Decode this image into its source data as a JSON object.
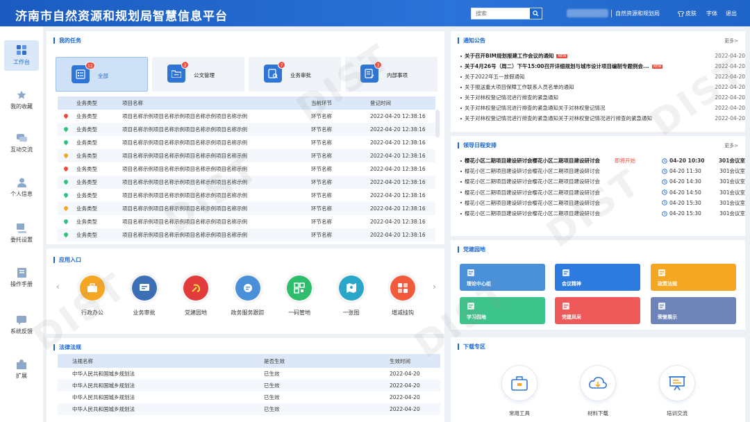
{
  "header": {
    "title": "济南市自然资源和规划局智慧信息平台",
    "search_placeholder": "搜索",
    "org_name": "自然资源和规划局",
    "links": {
      "skin": "皮肤",
      "font": "字体",
      "logout": "退出"
    }
  },
  "sidebar": {
    "items": [
      {
        "label": "工作台",
        "icon": "dashboard-icon"
      },
      {
        "label": "我的收藏",
        "icon": "star-icon"
      },
      {
        "label": "互动交流",
        "icon": "chat-icon"
      },
      {
        "label": "个人信息",
        "icon": "user-icon"
      },
      {
        "label": "委托设置",
        "icon": "delegate-icon"
      },
      {
        "label": "操作手册",
        "icon": "book-icon"
      },
      {
        "label": "系统反馈",
        "icon": "feedback-icon"
      },
      {
        "label": "扩展",
        "icon": "puzzle-icon"
      }
    ]
  },
  "tasks": {
    "title": "我的任务",
    "cards": [
      {
        "label": "全部",
        "badge": "12"
      },
      {
        "label": "公文管理",
        "badge": "2"
      },
      {
        "label": "业务审批",
        "badge": "7"
      },
      {
        "label": "内部事项",
        "badge": "3"
      }
    ],
    "columns": [
      "业务类型",
      "项目名称",
      "当前环节",
      "登记时间"
    ],
    "rows": [
      {
        "type": "业务类型",
        "name": "项目名称示例项目名称示例项目名称示例项目名称示例",
        "step": "环节名称",
        "time": "2022-04-20  12:38:16",
        "pin": "#ef4a3c"
      },
      {
        "type": "业务类型",
        "name": "项目名称示例项目名称示例项目名称示例项目名称示例",
        "step": "环节名称",
        "time": "2022-04-20  12:38:16",
        "pin": "#2ec27e"
      },
      {
        "type": "业务类型",
        "name": "项目名称示例项目名称示例项目名称示例项目名称示例",
        "step": "环节名称",
        "time": "2022-04-20  12:38:16",
        "pin": "#2ec27e"
      },
      {
        "type": "业务类型",
        "name": "项目名称示例项目名称示例项目名称示例项目名称示例",
        "step": "环节名称",
        "time": "2022-04-20  12:38:16",
        "pin": "#f5a623"
      },
      {
        "type": "业务类型",
        "name": "项目名称示例项目名称示例项目名称示例项目名称示例",
        "step": "环节名称",
        "time": "2022-04-20  12:38:16",
        "pin": "#ef4a3c"
      },
      {
        "type": "业务类型",
        "name": "项目名称示例项目名称示例项目名称示例项目名称示例",
        "step": "环节名称",
        "time": "2022-04-20  12:38:16",
        "pin": "#2ec27e"
      },
      {
        "type": "业务类型",
        "name": "项目名称示例项目名称示例项目名称示例项目名称示例",
        "step": "环节名称",
        "time": "2022-04-20  12:38:16",
        "pin": "#2ec27e"
      },
      {
        "type": "业务类型",
        "name": "项目名称示例项目名称示例项目名称示例项目名称示例",
        "step": "环节名称",
        "time": "2022-04-20  12:38:16",
        "pin": "#f5a623"
      },
      {
        "type": "业务类型",
        "name": "项目名称示例项目名称示例项目名称示例项目名称示例",
        "step": "环节名称",
        "time": "2022-04-20  12:38:16",
        "pin": "#2ec27e"
      },
      {
        "type": "业务类型",
        "name": "项目名称示例项目名称示例项目名称示例项目名称示例",
        "step": "环节名称",
        "time": "2022-04-20  12:38:16",
        "pin": "#2ec27e"
      }
    ]
  },
  "apps": {
    "title": "应用入口",
    "items": [
      {
        "label": "行政办公",
        "color": "#f5a623",
        "icon": "briefcase-icon"
      },
      {
        "label": "业务审批",
        "color": "#3b6fb6",
        "icon": "approval-icon"
      },
      {
        "label": "党建园地",
        "color": "#e23b3b",
        "icon": "party-emblem-icon"
      },
      {
        "label": "政务服务跟踪",
        "color": "#4a90d9",
        "icon": "tracking-icon"
      },
      {
        "label": "一码管地",
        "color": "#2ebd6b",
        "icon": "qrcode-icon"
      },
      {
        "label": "一张图",
        "color": "#2aa6c8",
        "icon": "map-icon"
      },
      {
        "label": "增减挂钩",
        "color": "#f15a3a",
        "icon": "grid-icon"
      }
    ]
  },
  "laws": {
    "title": "法律法规",
    "columns": [
      "法规名称",
      "是否生效",
      "生效时间"
    ],
    "rows": [
      {
        "name": "中华人民共和国城乡规划法",
        "status": "已生效",
        "date": "2022-04-20"
      },
      {
        "name": "中华人民共和国城乡规划法",
        "status": "已生效",
        "date": "2022-04-20"
      },
      {
        "name": "中华人民共和国城乡规划法",
        "status": "已生效",
        "date": "2022-04-20"
      },
      {
        "name": "中华人民共和国城乡规划法",
        "status": "已生效",
        "date": "2022-04-20"
      }
    ]
  },
  "notices": {
    "title": "通知公告",
    "more": "更多>",
    "items": [
      {
        "text": "关于召开BIM规划报建工作会议的通知",
        "date": "2022-04-20",
        "bold": true,
        "new": "NEW"
      },
      {
        "text": "关于4月26号（周二）下午15:00召开详细规划与城市设计项目编制专题例会...",
        "date": "2022-04-20",
        "bold": true,
        "new": "NEW"
      },
      {
        "text": "关于2022年五一放假通知",
        "date": "2022-04-20",
        "bold": false,
        "new": ""
      },
      {
        "text": "关于报送重大项目保障工作联系人员名单的通知",
        "date": "2022-04-20",
        "bold": false,
        "new": ""
      },
      {
        "text": "关于对林权登记情况进行排查的紧急通知",
        "date": "2022-04-20",
        "bold": false,
        "new": ""
      },
      {
        "text": "关于对林权登记情况进行排查的紧急通知关于对林权登记情况",
        "date": "2022-04-20",
        "bold": false,
        "new": ""
      },
      {
        "text": "关于对林权登记情况进行排查的紧急通知关于对林权登记情况进行排查的紧急通知",
        "date": "2022-04-20",
        "bold": false,
        "new": ""
      }
    ]
  },
  "schedule": {
    "title": "领导日程安排",
    "more": "更多>",
    "items": [
      {
        "text": "樱花小区二期项目建设研讨会樱花小区二期项目建设研讨会",
        "status": "即将开始",
        "time": "04-20  10:30",
        "room": "301会议室"
      },
      {
        "text": "樱花小区二期项目建设研讨会樱花小区二期项目建设研讨会",
        "status": "",
        "time": "04-20  11:30",
        "room": "301会议室"
      },
      {
        "text": "樱花小区二期项目建设研讨会樱花小区二期项目建设研讨会",
        "status": "",
        "time": "04-20  14:30",
        "room": "301会议室"
      },
      {
        "text": "樱花小区二期项目建设研讨会樱花小区二期项目建设研讨会",
        "status": "",
        "time": "04-20  14:50",
        "room": "301会议室"
      },
      {
        "text": "樱花小区二期项目建设研讨会樱花小区二期项目建设研讨会",
        "status": "",
        "time": "04-20  15:30",
        "room": "301会议室"
      },
      {
        "text": "樱花小区二期项目建设研讨会樱花小区二期项目建设研讨会",
        "status": "",
        "time": "04-20  15:30",
        "room": "301会议室"
      }
    ]
  },
  "party": {
    "title": "党建园地",
    "cards": [
      {
        "label": "理论中心组",
        "color": "#4a90d9"
      },
      {
        "label": "会议精神",
        "color": "#2e7be0"
      },
      {
        "label": "政策法规",
        "color": "#f5a623"
      },
      {
        "label": "学习园地",
        "color": "#3cc48a"
      },
      {
        "label": "党建风采",
        "color": "#ee5a5a"
      },
      {
        "label": "荣誉展示",
        "color": "#6e84b8"
      }
    ]
  },
  "downloads": {
    "title": "下载专区",
    "items": [
      {
        "label": "常用工具",
        "icon": "toolbox-icon"
      },
      {
        "label": "材料下载",
        "icon": "cloud-download-icon"
      },
      {
        "label": "培训交流",
        "icon": "presentation-icon"
      }
    ]
  },
  "watermark": "DIST"
}
